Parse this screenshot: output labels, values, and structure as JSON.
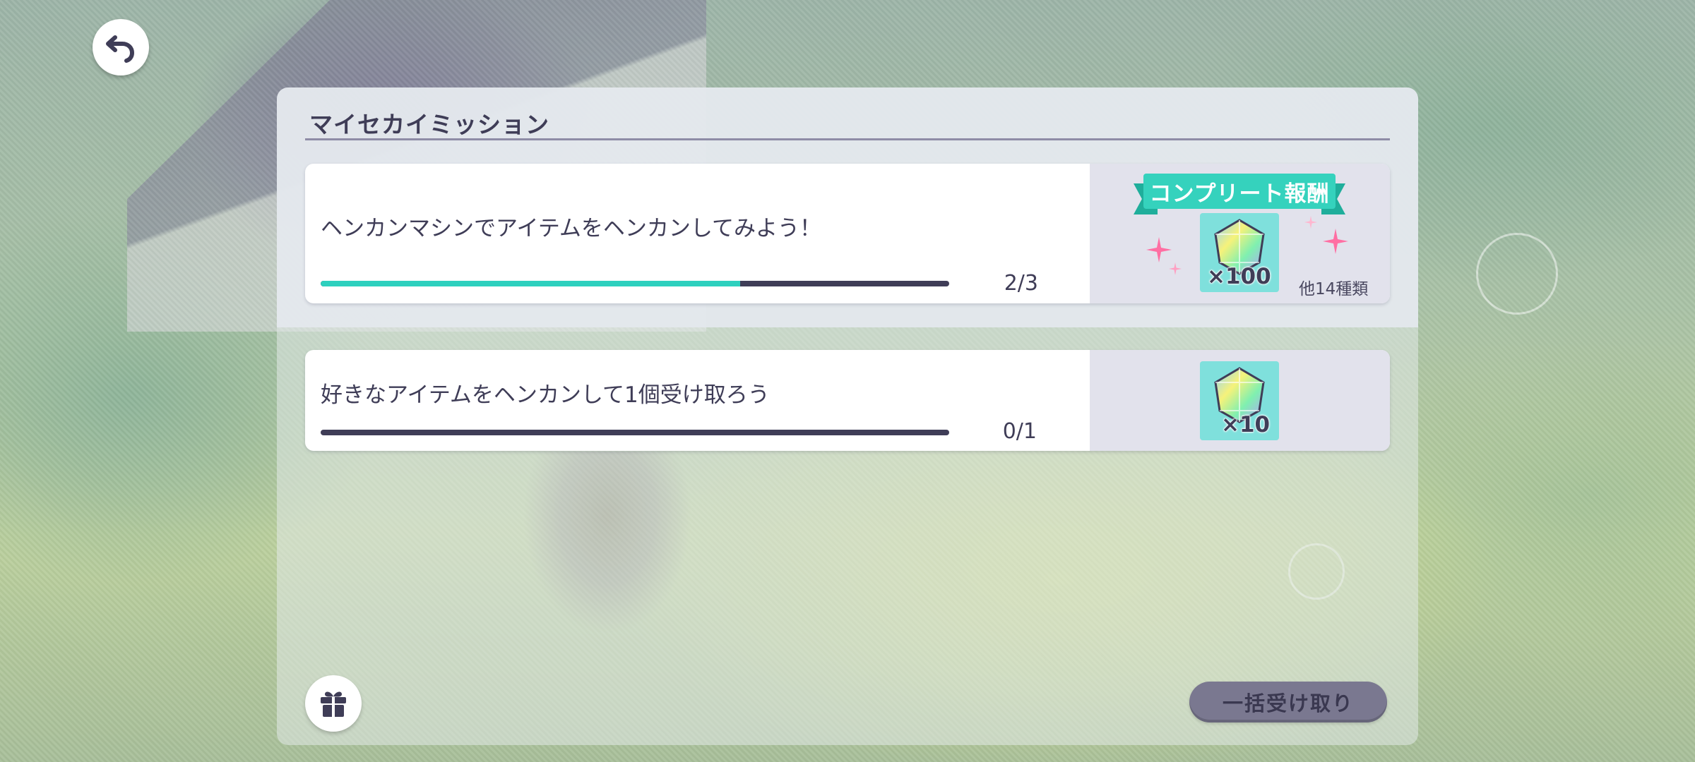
{
  "panel": {
    "title": "マイセカイミッション"
  },
  "missions": [
    {
      "text": "ヘンカンマシンでアイテムをヘンカンしてみよう！",
      "current": 2,
      "total": 3,
      "progress_label": "2/3",
      "progress_fraction": 0.667,
      "reward": {
        "banner": "コンプリート報酬",
        "item_icon": "rainbow-gem-icon",
        "quantity": "×100",
        "others": "他14種類"
      }
    },
    {
      "text": "好きなアイテムをヘンカンして1個受け取ろう",
      "current": 0,
      "total": 1,
      "progress_label": "0/1",
      "progress_fraction": 0,
      "reward": {
        "item_icon": "rainbow-gem-icon",
        "quantity": "×10"
      }
    }
  ],
  "buttons": {
    "back_icon": "back-arrow-icon",
    "gift_icon": "gift-icon",
    "claim_all": "一括受け取り"
  },
  "colors": {
    "accent": "#2dd0be",
    "text": "#3f3d57",
    "bar_track": "#3f3d57",
    "gem_bg": "#7fe0dc",
    "reward_bg": "#e2e2ec",
    "banner": "#35d2bd",
    "claim_button": "#7a7890"
  }
}
